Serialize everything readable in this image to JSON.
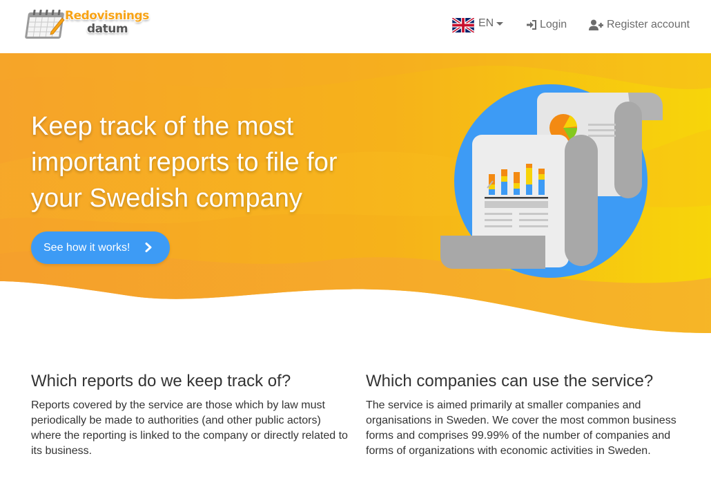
{
  "brand": {
    "line1": "Redovisnings",
    "line2": "datum",
    "logo_icon": "calendar-pencil-icon"
  },
  "nav": {
    "language": {
      "code": "EN",
      "flag_icon": "uk-flag-icon"
    },
    "login": {
      "label": "Login",
      "icon": "sign-in-icon"
    },
    "register": {
      "label": "Register account",
      "icon": "user-plus-icon"
    }
  },
  "hero": {
    "title": "Keep track of the most important reports to file for your Swedish company",
    "cta_label": "See how it works!",
    "cta_icon": "chevron-right-icon",
    "illustration_icon": "report-scroll-chart-icon"
  },
  "sections": [
    {
      "heading": "Which reports do we keep track of?",
      "body": "Reports covered by the service are those which by law must periodically be made to authorities (and other public actors) where the reporting is linked to the company or directly related to its business."
    },
    {
      "heading": "Which companies can use the service?",
      "body": "The service is aimed primarily at smaller companies and organisations in Sweden. We cover the most common business forms and comprises 99.99% of the number of companies and forms of organizations with economic activities in Sweden."
    }
  ],
  "colors": {
    "accent": "#3d9bf5",
    "hero_orange": "#f6a623",
    "hero_yellow": "#f7d308",
    "text": "#333333"
  }
}
